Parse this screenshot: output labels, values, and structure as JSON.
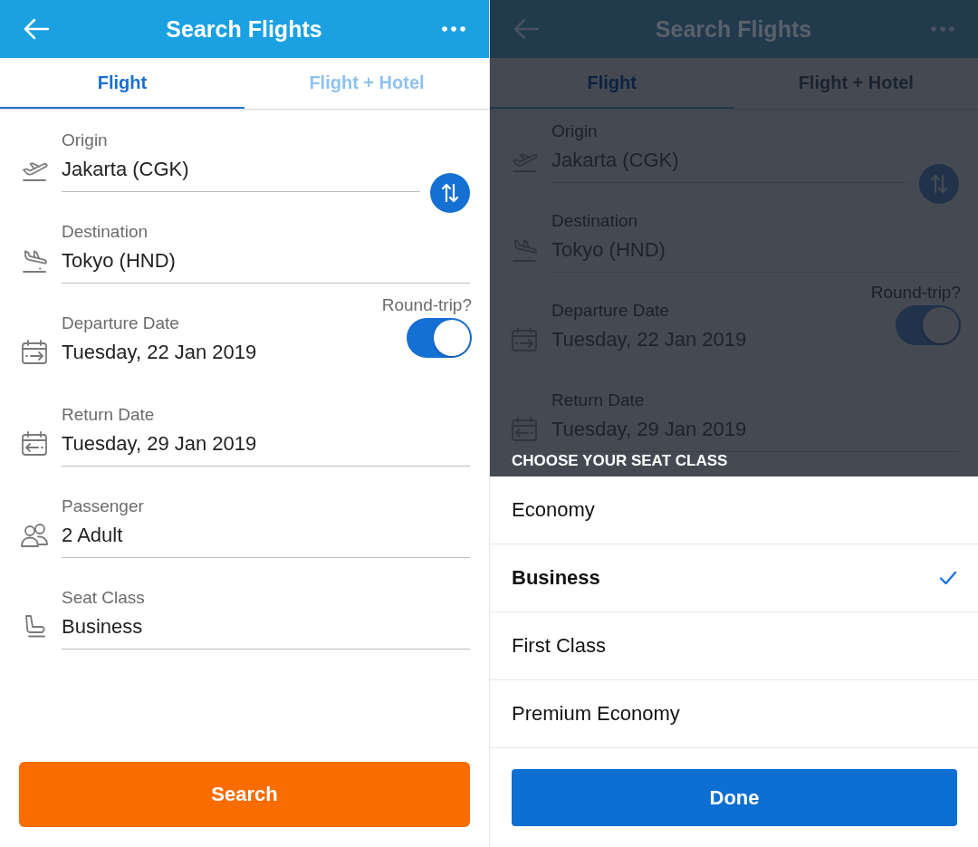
{
  "screens": [
    {
      "header": {
        "title": "Search Flights"
      },
      "tabs": [
        {
          "label": "Flight",
          "selected": true
        },
        {
          "label": "Flight + Hotel",
          "selected": false
        }
      ],
      "fields": [
        {
          "kind": "origin",
          "label": "Origin",
          "value": "Jakarta (CGK)"
        },
        {
          "kind": "destination",
          "label": "Destination",
          "value": "Tokyo (HND)"
        },
        {
          "kind": "departure",
          "label": "Departure Date",
          "value": "Tuesday, 22 Jan 2019",
          "toggle": {
            "label": "Round-trip?",
            "on": true
          }
        },
        {
          "kind": "return",
          "label": "Return Date",
          "value": "Tuesday, 29 Jan 2019"
        },
        {
          "kind": "passenger",
          "label": "Passenger",
          "value": "2 Adult"
        },
        {
          "kind": "seat",
          "label": "Seat Class",
          "value": "Business"
        }
      ],
      "search_button": {
        "label": "Search"
      }
    },
    {
      "header": {
        "title": "Search Flights"
      },
      "tabs": [
        {
          "label": "Flight",
          "selected": true
        },
        {
          "label": "Flight + Hotel",
          "selected": false
        }
      ],
      "fields": [
        {
          "kind": "origin",
          "label": "Origin",
          "value": "Jakarta (CGK)"
        },
        {
          "kind": "destination",
          "label": "Destination",
          "value": "Tokyo (HND)"
        },
        {
          "kind": "departure",
          "label": "Departure Date",
          "value": "Tuesday, 22 Jan 2019",
          "toggle": {
            "label": "Round-trip?",
            "on": true
          }
        },
        {
          "kind": "return",
          "label": "Return Date",
          "value": "Tuesday, 29 Jan 2019"
        }
      ],
      "sheet": {
        "title": "CHOOSE YOUR SEAT CLASS",
        "options": [
          {
            "label": "Economy",
            "selected": false
          },
          {
            "label": "Business",
            "selected": true
          },
          {
            "label": "First Class",
            "selected": false
          },
          {
            "label": "Premium Economy",
            "selected": false
          }
        ],
        "done_button": {
          "label": "Done"
        }
      }
    }
  ]
}
